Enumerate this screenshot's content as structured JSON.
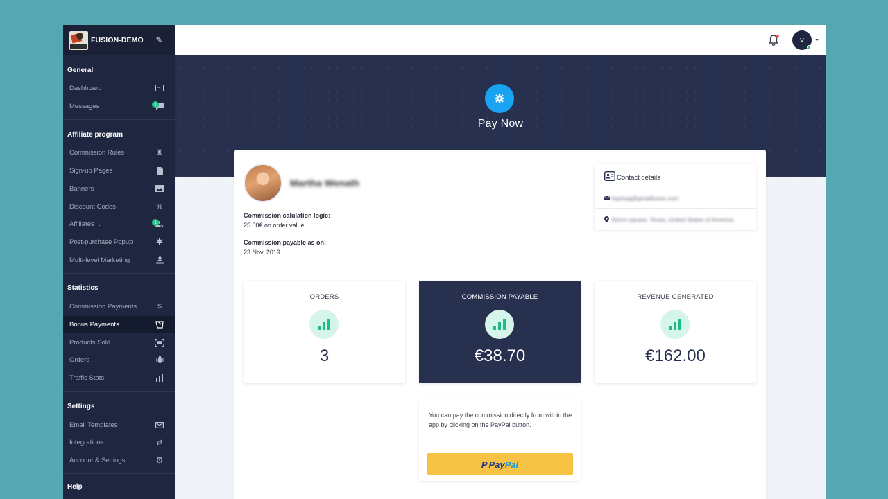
{
  "brand": {
    "name": "FUSION-DEMO",
    "logo_text": "COFFEESHOP"
  },
  "sidebar": {
    "sections": [
      {
        "title": "General"
      },
      {
        "title": "Affiliate program"
      },
      {
        "title": "Statistics"
      },
      {
        "title": "Settings"
      },
      {
        "title": "Help"
      }
    ],
    "items": [
      {
        "label": "Dashboard",
        "icon": "dashboard-icon"
      },
      {
        "label": "Messages",
        "icon": "message-icon",
        "badge": "4"
      },
      {
        "label": "Commission Rules",
        "icon": "chess-rook-icon"
      },
      {
        "label": "Sign-up Pages",
        "icon": "file-icon"
      },
      {
        "label": "Banners",
        "icon": "image-icon"
      },
      {
        "label": "Discount Codes",
        "icon": "percent-icon"
      },
      {
        "label": "Affiliates",
        "icon": "user-network-icon",
        "badge": "1",
        "caret": "⌄"
      },
      {
        "label": "Post-purchase Popup",
        "icon": "asterisk-icon"
      },
      {
        "label": "Multi-level Marketing",
        "icon": "user-tier-icon"
      },
      {
        "label": "Commission Payments",
        "icon": "dollar-icon"
      },
      {
        "label": "Bonus Payments",
        "icon": "gift-icon",
        "active": true
      },
      {
        "label": "Products Sold",
        "icon": "scan-icon"
      },
      {
        "label": "Orders",
        "icon": "bug-icon"
      },
      {
        "label": "Traffic Stats",
        "icon": "bar-chart-icon"
      },
      {
        "label": "Email Templates",
        "icon": "mail-icon"
      },
      {
        "label": "Integrations",
        "icon": "sync-icon"
      },
      {
        "label": "Account & Settings",
        "icon": "cog-icon"
      }
    ]
  },
  "topbar": {
    "avatar_initial": "v",
    "notification": true
  },
  "hero": {
    "title": "Pay Now"
  },
  "profile": {
    "name": "Martha Wenath",
    "commission_logic_label": "Commission calulation logic:",
    "commission_logic_value": "25.00€ on order value",
    "payable_label": "Commission payable as on:",
    "payable_value": "23 Nov, 2019"
  },
  "contact": {
    "title": "Contact details",
    "email": "hsjshag@gmailtvans.com",
    "address": "Storm square, Texas, United States of America"
  },
  "stats": [
    {
      "label": "ORDERS",
      "value": "3",
      "dark": false
    },
    {
      "label": "COMMISSION PAYABLE",
      "value": "€38.70",
      "dark": true
    },
    {
      "label": "REVENUE GENERATED",
      "value": "€162.00",
      "dark": false
    }
  ],
  "payment": {
    "text": "You can pay the commission directly from within the app by clicking on the PayPal button.",
    "paypal_pay": "Pay",
    "paypal_pal": "Pal",
    "paypal_mark": "P"
  },
  "colors": {
    "sidebar": "#1f2740",
    "hero": "#283050",
    "accent_blue": "#1aa3f2",
    "success": "#26c28a",
    "paypal_yellow": "#f6c344"
  }
}
